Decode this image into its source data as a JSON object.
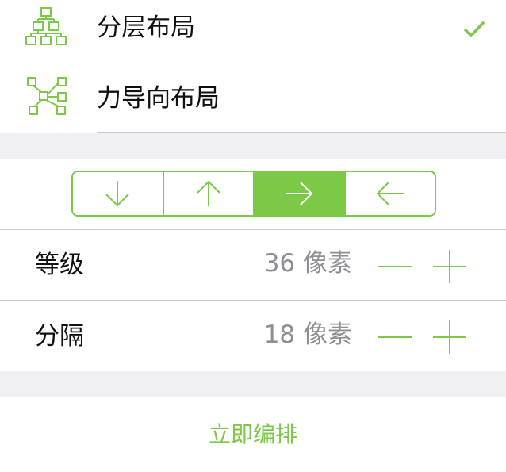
{
  "layouts": [
    {
      "label": "分层布局",
      "icon": "hierarchy-layout-icon",
      "selected": true
    },
    {
      "label": "力导向布局",
      "icon": "force-directed-layout-icon",
      "selected": false
    }
  ],
  "direction": {
    "options": [
      "down",
      "up",
      "right",
      "left"
    ],
    "selected": "right"
  },
  "settings": [
    {
      "label": "等级",
      "value": "36 像素"
    },
    {
      "label": "分隔",
      "value": "18 像素"
    }
  ],
  "action": {
    "label": "立即编排"
  },
  "colors": {
    "accent": "#7cc847",
    "background": "#efeff4",
    "separator": "#c8c7cc",
    "value_text": "#8e8e93"
  }
}
